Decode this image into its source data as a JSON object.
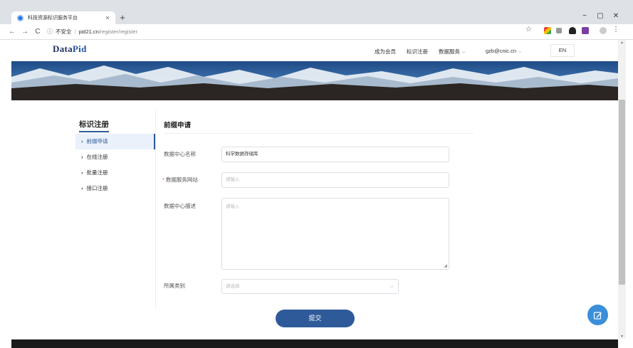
{
  "browser": {
    "tab_title": "科技资源标识服务平台",
    "tab_close": "×",
    "new_tab": "+",
    "back": "←",
    "forward": "→",
    "reload": "C",
    "security_text": "不安全",
    "url_host": "pid21.cn",
    "url_path": "/register/register",
    "minimize": "−",
    "maximize": "▢",
    "close": "✕"
  },
  "site_header": {
    "logo_data": "Data",
    "logo_pid": "Pid",
    "nav": {
      "member": "成为会员",
      "register": "标识注册",
      "data_service": "数据服务",
      "user": "gzb@cnic.cn",
      "lang": "EN"
    }
  },
  "sidebar": {
    "title": "标识注册",
    "items": [
      {
        "label": "前缀申请",
        "active": true
      },
      {
        "label": "在线注册",
        "active": false
      },
      {
        "label": "批量注册",
        "active": false
      },
      {
        "label": "接口注册",
        "active": false
      }
    ]
  },
  "form": {
    "title": "前缀申请",
    "fields": {
      "center_name": {
        "label": "数据中心名称",
        "value": "科学数据存储库"
      },
      "service_site": {
        "label": "数据服务网站",
        "placeholder": "请输入",
        "required": true
      },
      "description": {
        "label": "数据中心描述",
        "placeholder": "请输入"
      },
      "category": {
        "label": "所属类别",
        "placeholder": "请选择"
      }
    },
    "submit_label": "提交"
  },
  "colors": {
    "accent": "#2f5a9a",
    "required": "#e74c3c",
    "fab": "#3a8fd8"
  }
}
